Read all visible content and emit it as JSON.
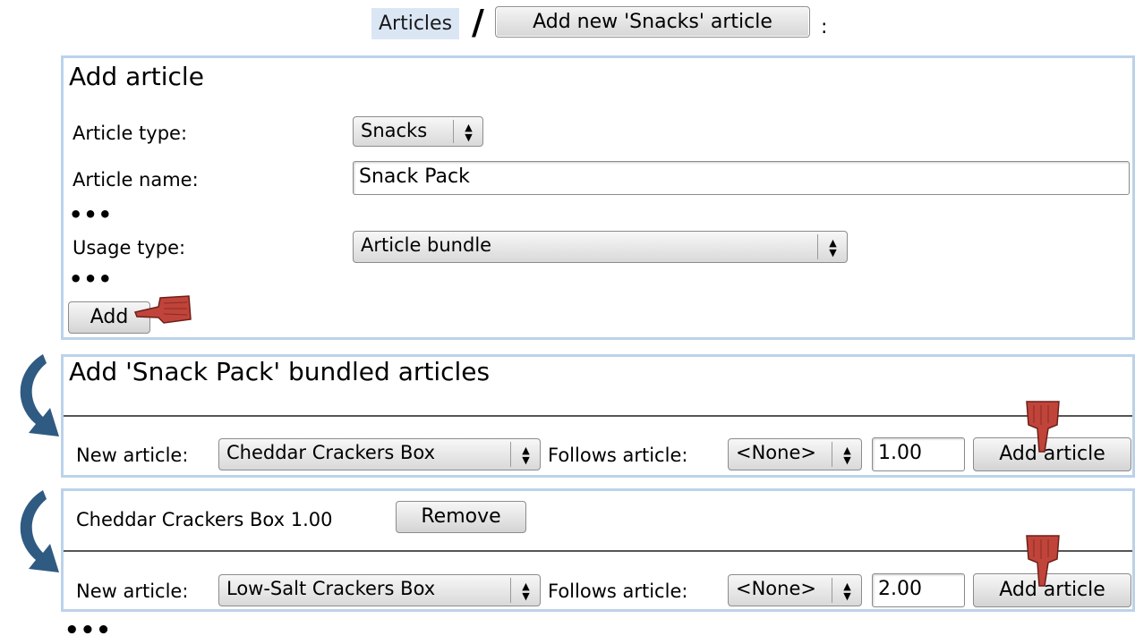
{
  "breadcrumb": {
    "articles_link": "Articles",
    "separator": "/",
    "add_button": "Add new 'Snacks' article",
    "trailing": ":"
  },
  "add_article": {
    "title": "Add article",
    "type_label": "Article type:",
    "type_value": "Snacks",
    "name_label": "Article name:",
    "name_value": "Snack Pack",
    "ellipsis": "•••",
    "usage_label": "Usage type:",
    "usage_value": "Article bundle",
    "add_button": "Add"
  },
  "bundle_panel": {
    "title": "Add 'Snack Pack' bundled articles",
    "new_article_label": "New article:",
    "new_article_value": "Cheddar Crackers Box",
    "follows_label": "Follows article:",
    "follows_value": "<None>",
    "quantity": "1.00",
    "add_button": "Add article"
  },
  "bundle_panel_2": {
    "item_text": "Cheddar Crackers Box 1.00",
    "remove_button": "Remove",
    "new_article_label": "New article:",
    "new_article_value": "Low-Salt Crackers Box",
    "follows_label": "Follows article:",
    "follows_value": "<None>",
    "quantity": "2.00",
    "add_button": "Add article"
  },
  "footer_ellipsis": "•••",
  "icons": {
    "pointer": "hand-pointer-icon",
    "flow": "curved-arrow-icon",
    "select_arrow": "up-down-arrows-icon"
  },
  "colors": {
    "panel_border": "#bcd2ea",
    "link_bg": "#dbe6f5",
    "hand": "#c0443a",
    "arrow": "#2f5a82"
  }
}
